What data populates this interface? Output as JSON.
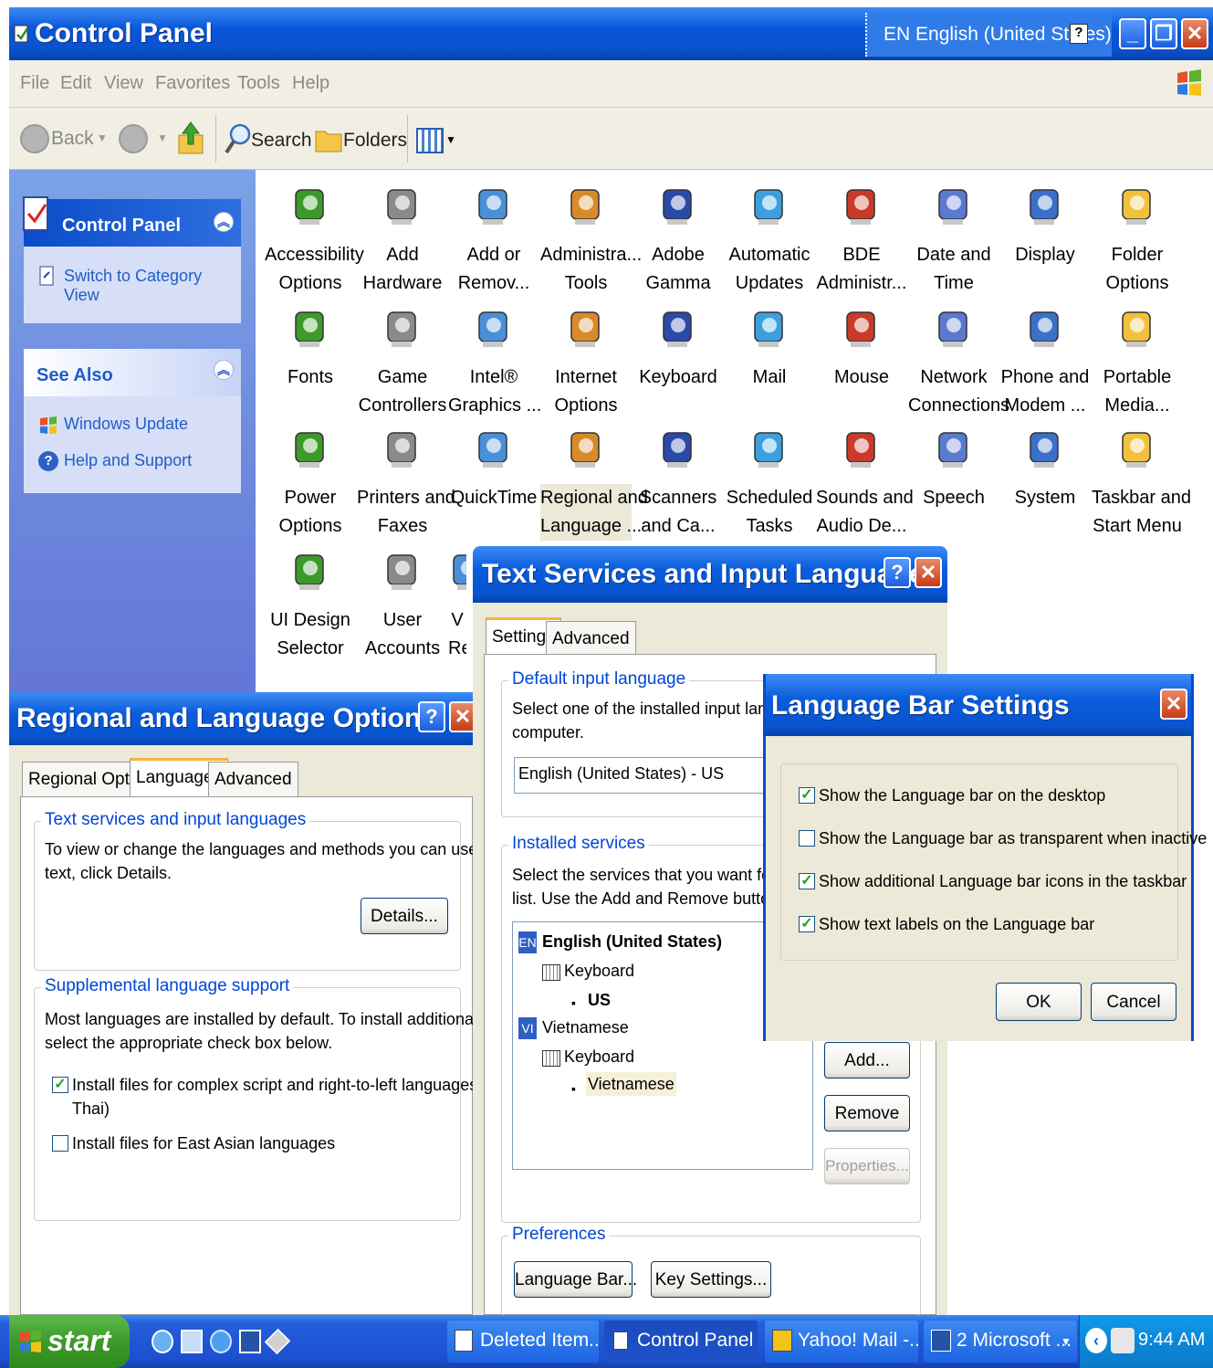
{
  "main_window": {
    "title": "Control Panel",
    "language_indicator": "EN English (United States)",
    "menu": [
      "File",
      "Edit",
      "View",
      "Favorites",
      "Tools",
      "Help"
    ],
    "toolbar": {
      "back": "Back",
      "search": "Search",
      "folders": "Folders"
    }
  },
  "taskpane": {
    "control_panel_header": "Control Panel",
    "switch_view": "Switch to Category View",
    "see_also_header": "See Also",
    "links": [
      "Windows Update",
      "Help and Support"
    ]
  },
  "control_panel_items": [
    {
      "line1": "Accessibility",
      "line2": "Options",
      "icon": "accessibility-icon"
    },
    {
      "line1": "Add",
      "line2": "Hardware",
      "icon": "add-hardware-icon"
    },
    {
      "line1": "Add or",
      "line2": "Remov...",
      "icon": "add-remove-programs-icon"
    },
    {
      "line1": "Administra...",
      "line2": "Tools",
      "icon": "administrative-tools-icon"
    },
    {
      "line1": "Adobe",
      "line2": "Gamma",
      "icon": "adobe-gamma-icon"
    },
    {
      "line1": "Automatic",
      "line2": "Updates",
      "icon": "automatic-updates-icon"
    },
    {
      "line1": "BDE",
      "line2": "Administr...",
      "icon": "bde-admin-icon"
    },
    {
      "line1": "Date and",
      "line2": "Time",
      "icon": "date-time-icon"
    },
    {
      "line1": "Display",
      "line2": "",
      "icon": "display-icon"
    },
    {
      "line1": "Folder",
      "line2": "Options",
      "icon": "folder-options-icon"
    },
    {
      "line1": "Fonts",
      "line2": "",
      "icon": "fonts-icon"
    },
    {
      "line1": "Game",
      "line2": "Controllers",
      "icon": "game-controllers-icon"
    },
    {
      "line1": "Intel®",
      "line2": "Graphics ...",
      "icon": "intel-graphics-icon"
    },
    {
      "line1": "Internet",
      "line2": "Options",
      "icon": "internet-options-icon"
    },
    {
      "line1": "Keyboard",
      "line2": "",
      "icon": "keyboard-icon"
    },
    {
      "line1": "Mail",
      "line2": "",
      "icon": "mail-icon"
    },
    {
      "line1": "Mouse",
      "line2": "",
      "icon": "mouse-icon"
    },
    {
      "line1": "Network",
      "line2": "Connections",
      "icon": "network-icon"
    },
    {
      "line1": "Phone and",
      "line2": "Modem ...",
      "icon": "phone-modem-icon"
    },
    {
      "line1": "Portable",
      "line2": "Media...",
      "icon": "portable-media-icon"
    },
    {
      "line1": "Power",
      "line2": "Options",
      "icon": "power-options-icon"
    },
    {
      "line1": "Printers and",
      "line2": "Faxes",
      "icon": "printers-icon"
    },
    {
      "line1": "QuickTime",
      "line2": "",
      "icon": "quicktime-icon"
    },
    {
      "line1": "Regional and",
      "line2": "Language ...",
      "icon": "regional-language-icon"
    },
    {
      "line1": "Scanners",
      "line2": "and Ca...",
      "icon": "scanners-icon"
    },
    {
      "line1": "Scheduled",
      "line2": "Tasks",
      "icon": "scheduled-tasks-icon"
    },
    {
      "line1": "Sounds and",
      "line2": "Audio De...",
      "icon": "sounds-icon"
    },
    {
      "line1": "Speech",
      "line2": "",
      "icon": "speech-icon"
    },
    {
      "line1": "System",
      "line2": "",
      "icon": "system-icon"
    },
    {
      "line1": "Taskbar and",
      "line2": "Start Menu",
      "icon": "taskbar-icon"
    },
    {
      "line1": "UI Design",
      "line2": "Selector",
      "icon": "ui-design-icon"
    },
    {
      "line1": "User",
      "line2": "Accounts",
      "icon": "user-accounts-icon"
    },
    {
      "line1": "V",
      "line2": "Re",
      "icon": "partial-icon"
    }
  ],
  "regional_dialog": {
    "title": "Regional and Language Options",
    "tabs": [
      "Regional Options",
      "Languages",
      "Advanced"
    ],
    "group1_title": "Text services and input languages",
    "group1_text1": "To view or change the languages and methods you can use to enter",
    "group1_text2": "text, click Details.",
    "details_button": "Details...",
    "group2_title": "Supplemental language support",
    "group2_text1": "Most languages are installed by default. To install additional languages,",
    "group2_text2": "select the appropriate check box below.",
    "check1_line1": "Install files for complex script and right-to-left languages (including",
    "check1_line2": "Thai)",
    "check2": "Install files for East Asian languages",
    "check1_checked": true,
    "check2_checked": false
  },
  "text_services_dialog": {
    "title": "Text Services and Input Languages",
    "tabs": [
      "Settings",
      "Advanced"
    ],
    "default_title": "Default input language",
    "default_text1": "Select one of the installed input languages to",
    "default_text2": "computer.",
    "default_value": "English (United States) - US",
    "installed_title": "Installed services",
    "installed_text1": "Select the services that you want for each in",
    "installed_text2": "list. Use the Add and Remove buttons to mo",
    "tree": {
      "en_badge": "EN",
      "en_label": "English (United States)",
      "en_keyboard": "Keyboard",
      "en_layout": "US",
      "vi_badge": "VI",
      "vi_label": "Vietnamese",
      "vi_keyboard": "Keyboard",
      "vi_layout": "Vietnamese"
    },
    "add_button": "Add...",
    "remove_button": "Remove",
    "properties_button": "Properties...",
    "preferences_title": "Preferences",
    "language_bar_button": "Language Bar...",
    "key_settings_button": "Key Settings..."
  },
  "language_bar_dialog": {
    "title": "Language Bar Settings",
    "options": [
      {
        "label": "Show the Language bar on the desktop",
        "checked": true
      },
      {
        "label": "Show the Language bar as transparent when inactive",
        "checked": false
      },
      {
        "label": "Show additional Language bar icons in the taskbar",
        "checked": true
      },
      {
        "label": "Show text labels on the Language bar",
        "checked": true
      }
    ],
    "ok": "OK",
    "cancel": "Cancel"
  },
  "taskbar": {
    "start": "start",
    "tasks": [
      "Deleted Item...",
      "Control Panel",
      "Yahoo! Mail -...",
      "2 Microsoft ..."
    ],
    "clock": "9:44 AM"
  },
  "colors": {
    "xp_blue": "#0a5ddc",
    "taskpane": "#6f8ae0",
    "dialog": "#ece9d8",
    "group_title": "#0046d5"
  }
}
